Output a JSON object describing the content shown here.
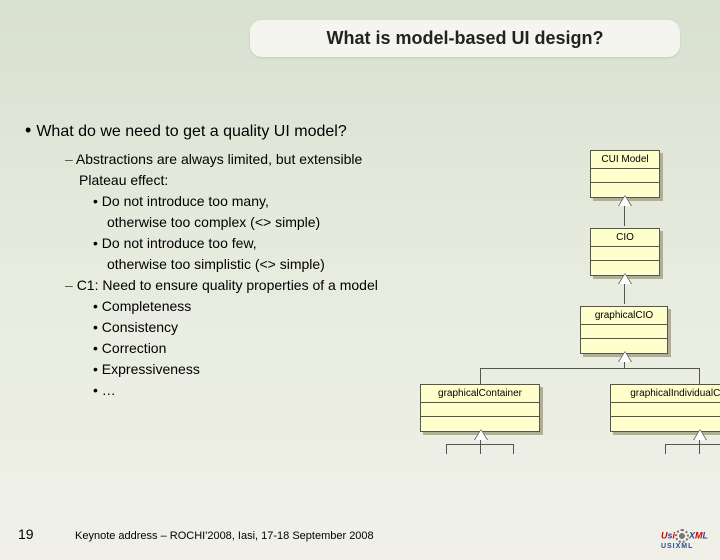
{
  "title": "What is model-based UI design?",
  "bullet_main": "What do we need to get a quality UI model?",
  "items": {
    "a1": "Abstractions are always limited, but extensible",
    "a2": "Plateau effect:",
    "a2a": "Do not introduce too many,",
    "a2b": "otherwise too complex (<> simple)",
    "a2c": "Do not introduce too few,",
    "a2d": "otherwise too simplistic (<> simple)",
    "c1": "C1: Need to ensure quality properties of a model",
    "c1a": "Completeness",
    "c1b": "Consistency",
    "c1c": "Correction",
    "c1d": "Expressiveness",
    "c1e": "…"
  },
  "uml": {
    "b1": "CUI Model",
    "b2": "CIO",
    "b3": "graphicalCIO",
    "b4": "graphicalContainer",
    "b5": "graphicalIndividualComponent"
  },
  "page": "19",
  "footer": "Keynote address – ROCHI'2008, Iasi, 17-18 September 2008",
  "logo": {
    "u": "U",
    "s": "s",
    "i": "i",
    "x": "X",
    "m": "M",
    "l": "L",
    "sub": "USIXML"
  }
}
